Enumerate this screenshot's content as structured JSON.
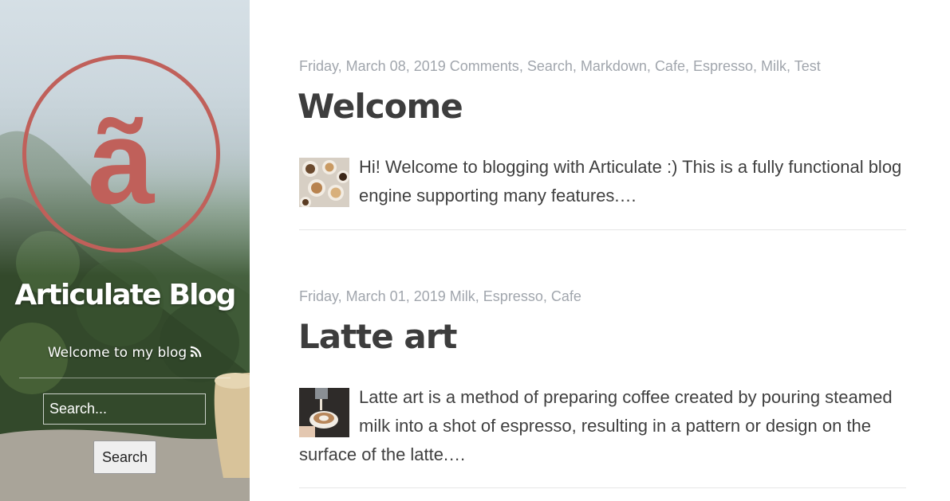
{
  "sidebar": {
    "logo_letter": "ã",
    "blog_title": "Articulate Blog",
    "tagline": "Welcome to my blog",
    "search": {
      "placeholder": "Search...",
      "button_label": "Search"
    }
  },
  "posts": [
    {
      "date": "Friday, March 08, 2019",
      "tags": [
        "Comments",
        "Search",
        "Markdown",
        "Cafe",
        "Espresso",
        "Milk",
        "Test"
      ],
      "title": "Welcome",
      "excerpt": "Hi! Welcome to blogging with Articulate :) This is a fully functional blog engine supporting many features.…"
    },
    {
      "date": "Friday, March 01, 2019",
      "tags": [
        "Milk",
        "Espresso",
        "Cafe"
      ],
      "title": "Latte art",
      "excerpt": "Latte art is a method of preparing coffee created by pouring steamed milk into a shot of espresso, resulting in a pattern or design on the surface of the latte.…"
    }
  ],
  "colors": {
    "logo_red": "#c0605a",
    "meta_gray": "#a1a6ad",
    "title_dark": "#3d3d3d",
    "text": "#3f3f3f"
  },
  "icons": [
    "rss-icon"
  ]
}
